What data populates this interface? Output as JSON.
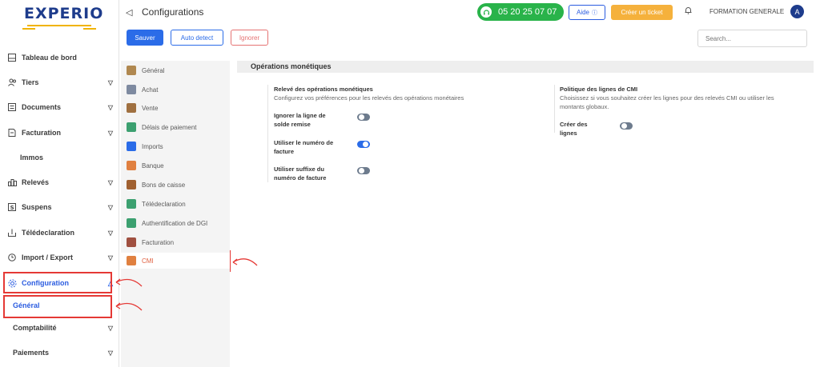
{
  "brand": {
    "name": "EXPERIO"
  },
  "sidebar": {
    "items": [
      {
        "label": "Tableau de bord",
        "icon": "dashboard-icon"
      },
      {
        "label": "Tiers",
        "icon": "users-icon"
      },
      {
        "label": "Documents",
        "icon": "document-icon"
      },
      {
        "label": "Facturation",
        "icon": "invoice-icon"
      },
      {
        "label": "Immos",
        "icon": ""
      },
      {
        "label": "Relevés",
        "icon": "bank-icon"
      },
      {
        "label": "Suspens",
        "icon": "suspense-icon"
      },
      {
        "label": "Télédeclaration",
        "icon": "upload-icon"
      },
      {
        "label": "Import / Export",
        "icon": "import-icon"
      },
      {
        "label": "Configuration",
        "icon": "gear-icon"
      },
      {
        "label": "Général",
        "icon": ""
      },
      {
        "label": "Comptabilité",
        "icon": ""
      },
      {
        "label": "Paiements",
        "icon": ""
      }
    ]
  },
  "header": {
    "title": "Configurations",
    "phone": "05 20 25 07 07",
    "help_label": "Aide",
    "ticket_label": "Créer un ticket",
    "company": "FORMATION GENERALE",
    "avatar_initial": "A"
  },
  "toolbar": {
    "save_label": "Sauver",
    "auto_label": "Auto detect",
    "ignore_label": "Ignorer",
    "search_placeholder": "Search..."
  },
  "settings_menu": {
    "items": [
      {
        "label": "Général",
        "color": "#b08850"
      },
      {
        "label": "Achat",
        "color": "#7e8aa0"
      },
      {
        "label": "Vente",
        "color": "#a07040"
      },
      {
        "label": "Délais de paiement",
        "color": "#3ca070"
      },
      {
        "label": "Imports",
        "color": "#2b6ce8"
      },
      {
        "label": "Banque",
        "color": "#e08040"
      },
      {
        "label": "Bons de caisse",
        "color": "#a06030"
      },
      {
        "label": "Télédeclaration",
        "color": "#3ca070"
      },
      {
        "label": "Authentification de DGI",
        "color": "#3ca070"
      },
      {
        "label": "Facturation",
        "color": "#a05040"
      },
      {
        "label": "CMI",
        "color": "#e08040"
      }
    ]
  },
  "content": {
    "section_title": "Opérations monétiques",
    "left": {
      "heading": "Relevé des opérations monétiques",
      "description": "Configurez vos préférences pour les relevés des opérations monétaires",
      "options": [
        {
          "label_line1": "Ignorer la ligne de",
          "label_line2": "solde remise",
          "enabled": false
        },
        {
          "label_line1": "Utiliser le numéro de",
          "label_line2": "facture",
          "enabled": true
        },
        {
          "label_line1": "Utiliser suffixe du",
          "label_line2": "numéro de facture",
          "enabled": false
        }
      ]
    },
    "right": {
      "heading": "Politique des lignes de CMI",
      "description_line1": "Choisissez si vous souhaitez créer les lignes pour des relevés CMI ou utiliser les",
      "description_line2": "montants globaux.",
      "options": [
        {
          "label_line1": "Créer des",
          "label_line2": "lignes",
          "enabled": false
        }
      ]
    }
  },
  "colors": {
    "primary": "#2b6ce8",
    "brand": "#1e3c8c",
    "accent": "#f5b13c",
    "phone": "#29b34a",
    "highlight": "#e53935"
  }
}
